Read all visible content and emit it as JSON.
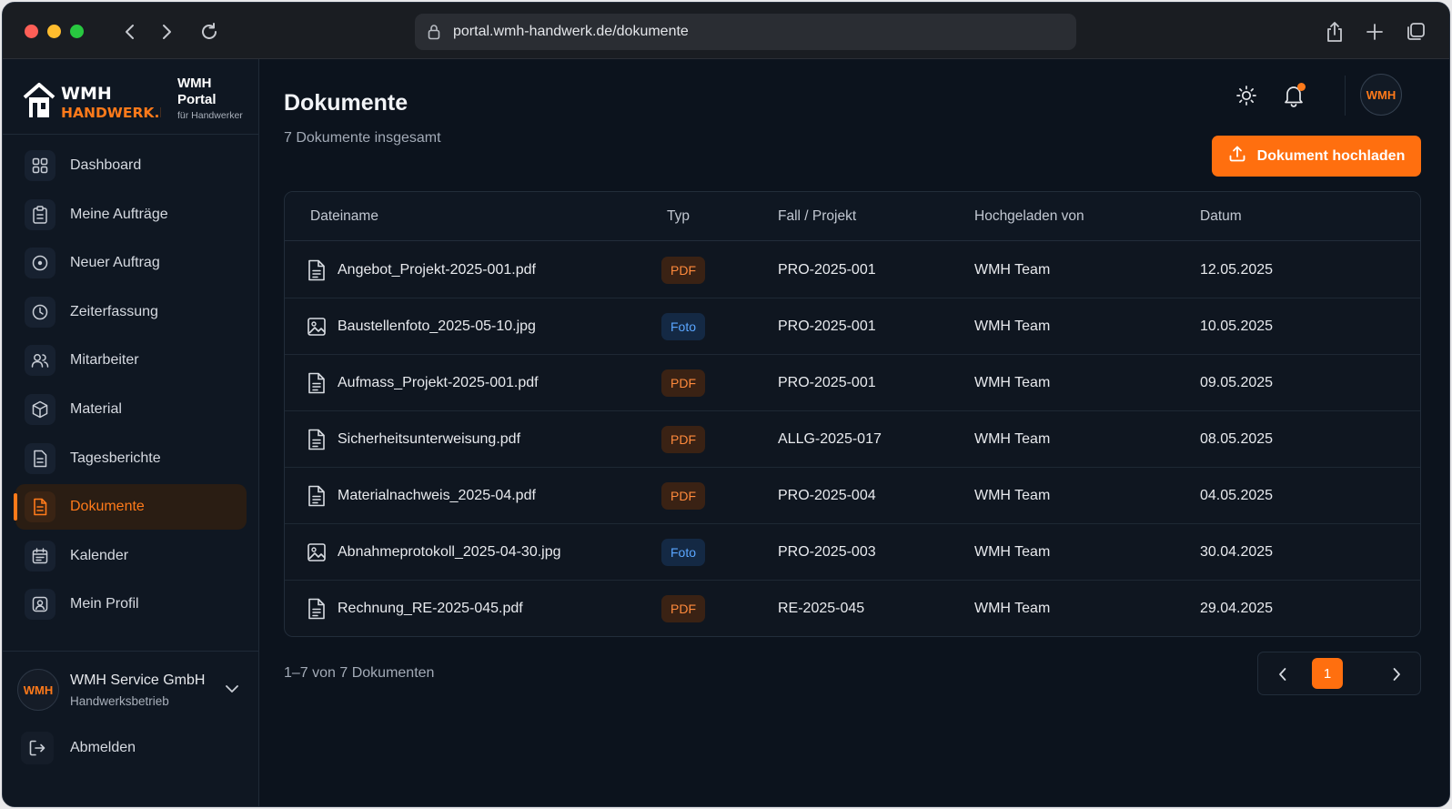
{
  "browser": {
    "url": "portal.wmh-handwerk.de/dokumente"
  },
  "brand": {
    "logo_text_1": "WMH",
    "logo_text_2": "HANDWERK.DE",
    "title_1": "WMH",
    "title_2": "Portal",
    "tagline": "für Handwerker"
  },
  "sidebar": {
    "items": [
      {
        "label": "Dashboard",
        "icon": "grid-icon"
      },
      {
        "label": "Meine Aufträge",
        "icon": "clipboard-icon"
      },
      {
        "label": "Neuer Auftrag",
        "icon": "plus-circle-icon"
      },
      {
        "label": "Zeiterfassung",
        "icon": "clock-icon"
      },
      {
        "label": "Mitarbeiter",
        "icon": "users-icon"
      },
      {
        "label": "Material",
        "icon": "box-icon"
      },
      {
        "label": "Tagesberichte",
        "icon": "report-icon"
      },
      {
        "label": "Dokumente",
        "icon": "document-icon",
        "active": true
      },
      {
        "label": "Kalender",
        "icon": "calendar-icon"
      },
      {
        "label": "Mein Profil",
        "icon": "profile-icon"
      }
    ],
    "company": {
      "avatar": "WMH",
      "name": "WMH Service GmbH",
      "type": "Handwerksbetrieb"
    },
    "logout_label": "Abmelden"
  },
  "header": {
    "title": "Dokumente",
    "subtitle": "7 Dokumente insgesamt",
    "avatar": "WMH",
    "upload_label": "Dokument hochladen"
  },
  "table": {
    "columns": [
      "Dateiname",
      "Typ",
      "Fall / Projekt",
      "Hochgeladen von",
      "Datum"
    ],
    "rows": [
      {
        "name": "Angebot_Projekt-2025-001.pdf",
        "type": "PDF",
        "project": "PRO-2025-001",
        "uploader": "WMH Team",
        "date": "12.05.2025"
      },
      {
        "name": "Baustellenfoto_2025-05-10.jpg",
        "type": "Foto",
        "project": "PRO-2025-001",
        "uploader": "WMH Team",
        "date": "10.05.2025"
      },
      {
        "name": "Aufmass_Projekt-2025-001.pdf",
        "type": "PDF",
        "project": "PRO-2025-001",
        "uploader": "WMH Team",
        "date": "09.05.2025"
      },
      {
        "name": "Sicherheitsunterweisung.pdf",
        "type": "PDF",
        "project": "ALLG-2025-017",
        "uploader": "WMH Team",
        "date": "08.05.2025"
      },
      {
        "name": "Materialnachweis_2025-04.pdf",
        "type": "PDF",
        "project": "PRO-2025-004",
        "uploader": "WMH Team",
        "date": "04.05.2025"
      },
      {
        "name": "Abnahmeprotokoll_2025-04-30.jpg",
        "type": "Foto",
        "project": "PRO-2025-003",
        "uploader": "WMH Team",
        "date": "30.04.2025"
      },
      {
        "name": "Rechnung_RE-2025-045.pdf",
        "type": "PDF",
        "project": "RE-2025-045",
        "uploader": "WMH Team",
        "date": "29.04.2025"
      }
    ]
  },
  "pagination": {
    "summary": "1–7 von 7 Dokumenten",
    "current_page": "1"
  },
  "colors": {
    "accent": "#ff6f0f",
    "background": "#0c131d",
    "sidebar": "#0f1722"
  }
}
